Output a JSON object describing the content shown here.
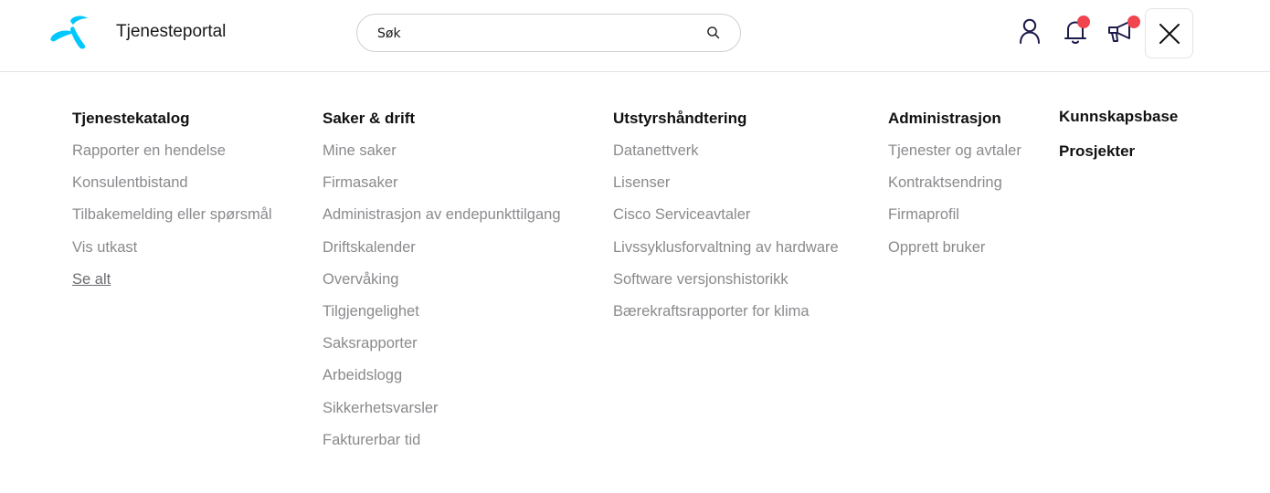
{
  "header": {
    "brand": "Tjenesteportal",
    "search": {
      "placeholder": "Søk"
    },
    "icons": [
      "user-icon",
      "bell-icon",
      "megaphone-icon",
      "close-icon"
    ],
    "accent": "#00c8ff",
    "notification_color": "#f0444f"
  },
  "menu": {
    "columns": [
      {
        "title": "Tjenestekatalog",
        "items": [
          "Rapporter en hendelse",
          "Konsulentbistand",
          "Tilbakemelding eller spørsmål",
          "Vis utkast"
        ],
        "see_all": "Se alt"
      },
      {
        "title": "Saker & drift",
        "items": [
          "Mine saker",
          "Firmasaker",
          "Administrasjon av endepunkttilgang",
          "Driftskalender",
          "Overvåking",
          "Tilgjengelighet",
          "Saksrapporter",
          "Arbeidslogg",
          "Sikkerhetsvarsler",
          "Fakturerbar tid"
        ]
      },
      {
        "title": "Utstyrshåndtering",
        "items": [
          "Datanettverk",
          "Lisenser",
          "Cisco Serviceavtaler",
          "Livssyklusforvaltning av hardware",
          "Software versjonshistorikk",
          "Bærekraftsrapporter for klima"
        ]
      },
      {
        "title": "Administrasjon",
        "items": [
          "Tjenester og avtaler",
          "Kontraktsendring",
          "Firmaprofil",
          "Opprett bruker"
        ]
      }
    ],
    "side_links": [
      "Kunnskapsbase",
      "Prosjekter"
    ]
  }
}
